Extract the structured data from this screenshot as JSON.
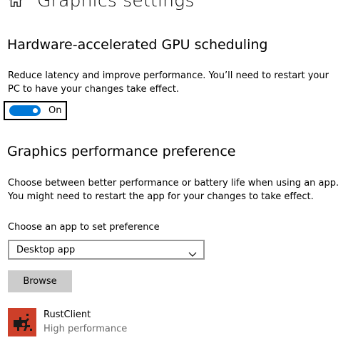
{
  "page_title": "Graphics settings",
  "gpu_scheduling": {
    "heading": "Hardware-accelerated GPU scheduling",
    "description_line1": "Reduce latency and improve performance. You’ll need to restart your",
    "description_line2": "PC to have your changes take effect.",
    "toggle_state": "On",
    "toggle_on": true
  },
  "performance_preference": {
    "heading": "Graphics performance preference",
    "description_line1": "Choose between better performance or battery life when using an app.",
    "description_line2": "You might need to restart the app for your changes to take effect.",
    "choose_label": "Choose an app to set preference",
    "dropdown_value": "Desktop app",
    "browse_label": "Browse"
  },
  "apps": [
    {
      "name": "RustClient",
      "preference": "High performance"
    }
  ],
  "colors": {
    "accent": "#0078d7",
    "app_icon_bg": "#cd3f29",
    "button_bg": "#cccccc",
    "secondary_text": "#6a6a6a"
  }
}
